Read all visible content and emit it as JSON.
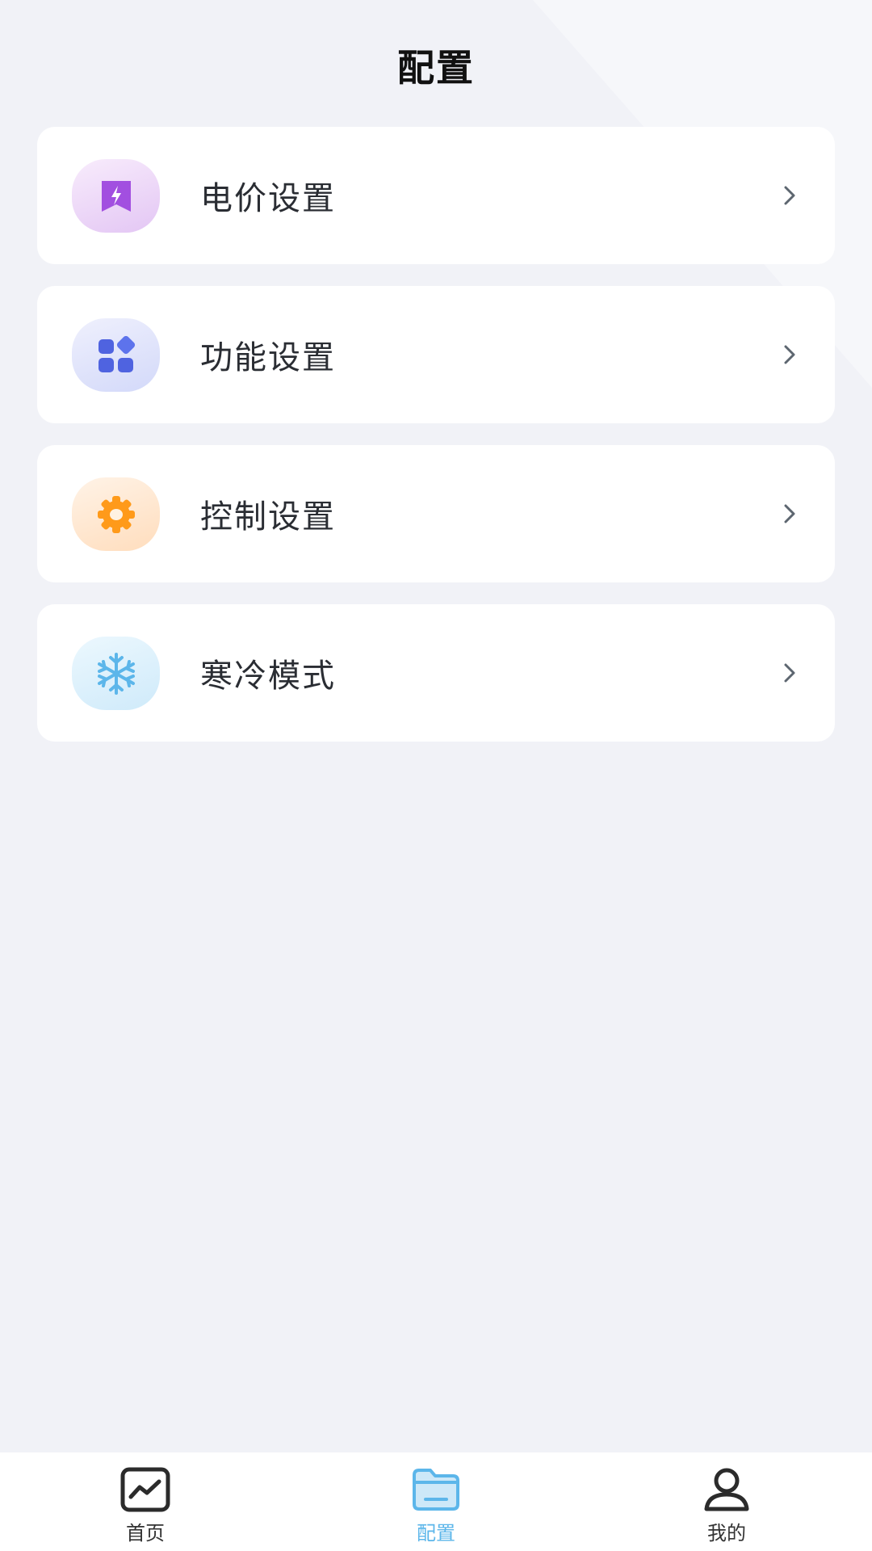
{
  "header": {
    "title": "配置"
  },
  "menu": {
    "items": [
      {
        "label": "电价设置",
        "icon": "price-tag-icon",
        "icon_bg": [
          "#f6e6fb",
          "#e6c9f5"
        ],
        "icon_color": "#a24fe0"
      },
      {
        "label": "功能设置",
        "icon": "apps-grid-icon",
        "icon_bg": [
          "#eceefc",
          "#d6dbfa"
        ],
        "icon_color": "#4f63e0"
      },
      {
        "label": "控制设置",
        "icon": "gear-icon",
        "icon_bg": [
          "#fff1e4",
          "#ffdfc2"
        ],
        "icon_color": "#ff9a1a"
      },
      {
        "label": "寒冷模式",
        "icon": "snowflake-icon",
        "icon_bg": [
          "#e8f6fd",
          "#d0ecfa"
        ],
        "icon_color": "#5cb6ea"
      }
    ]
  },
  "tabbar": {
    "tabs": [
      {
        "label": "首页",
        "icon": "chart-board-icon",
        "active": false
      },
      {
        "label": "配置",
        "icon": "folder-icon",
        "active": true
      },
      {
        "label": "我的",
        "icon": "person-icon",
        "active": false
      }
    ]
  },
  "colors": {
    "accent": "#5cb6ea",
    "background": "#f1f2f7",
    "text": "#2a2d33"
  }
}
